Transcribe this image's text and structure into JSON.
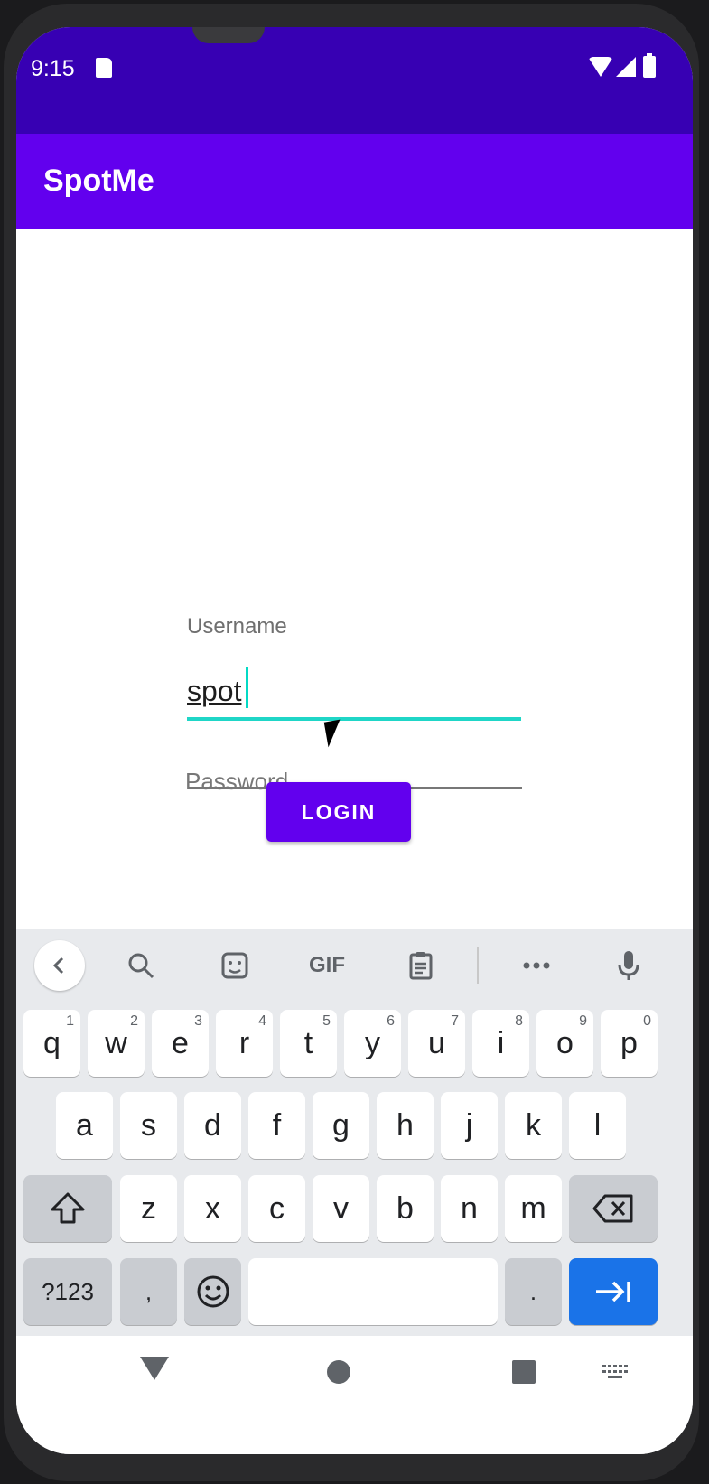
{
  "status": {
    "time": "9:15"
  },
  "app": {
    "title": "SpotMe"
  },
  "form": {
    "username_label": "Username",
    "username_value": "spot",
    "password_placeholder": "Password",
    "login_label": "LOGIN"
  },
  "keyboard": {
    "toolbar": {
      "back_icon": "chevron-left-icon",
      "search_icon": "search-icon",
      "sticker_icon": "sticker-icon",
      "gif_label": "GIF",
      "clipboard_icon": "clipboard-icon",
      "more_icon": "more-icon",
      "mic_icon": "microphone-icon"
    },
    "row1": [
      {
        "key": "q",
        "hint": "1"
      },
      {
        "key": "w",
        "hint": "2"
      },
      {
        "key": "e",
        "hint": "3"
      },
      {
        "key": "r",
        "hint": "4"
      },
      {
        "key": "t",
        "hint": "5"
      },
      {
        "key": "y",
        "hint": "6"
      },
      {
        "key": "u",
        "hint": "7"
      },
      {
        "key": "i",
        "hint": "8"
      },
      {
        "key": "o",
        "hint": "9"
      },
      {
        "key": "p",
        "hint": "0"
      }
    ],
    "row2": [
      "a",
      "s",
      "d",
      "f",
      "g",
      "h",
      "j",
      "k",
      "l"
    ],
    "row3": [
      "z",
      "x",
      "c",
      "v",
      "b",
      "n",
      "m"
    ],
    "row4": {
      "symbols_label": "?123",
      "comma": ",",
      "period": "."
    }
  },
  "colors": {
    "status_bar": "#3700b3",
    "app_bar": "#6200ee",
    "accent": "#03dac5",
    "enter_key": "#1a73e8"
  }
}
